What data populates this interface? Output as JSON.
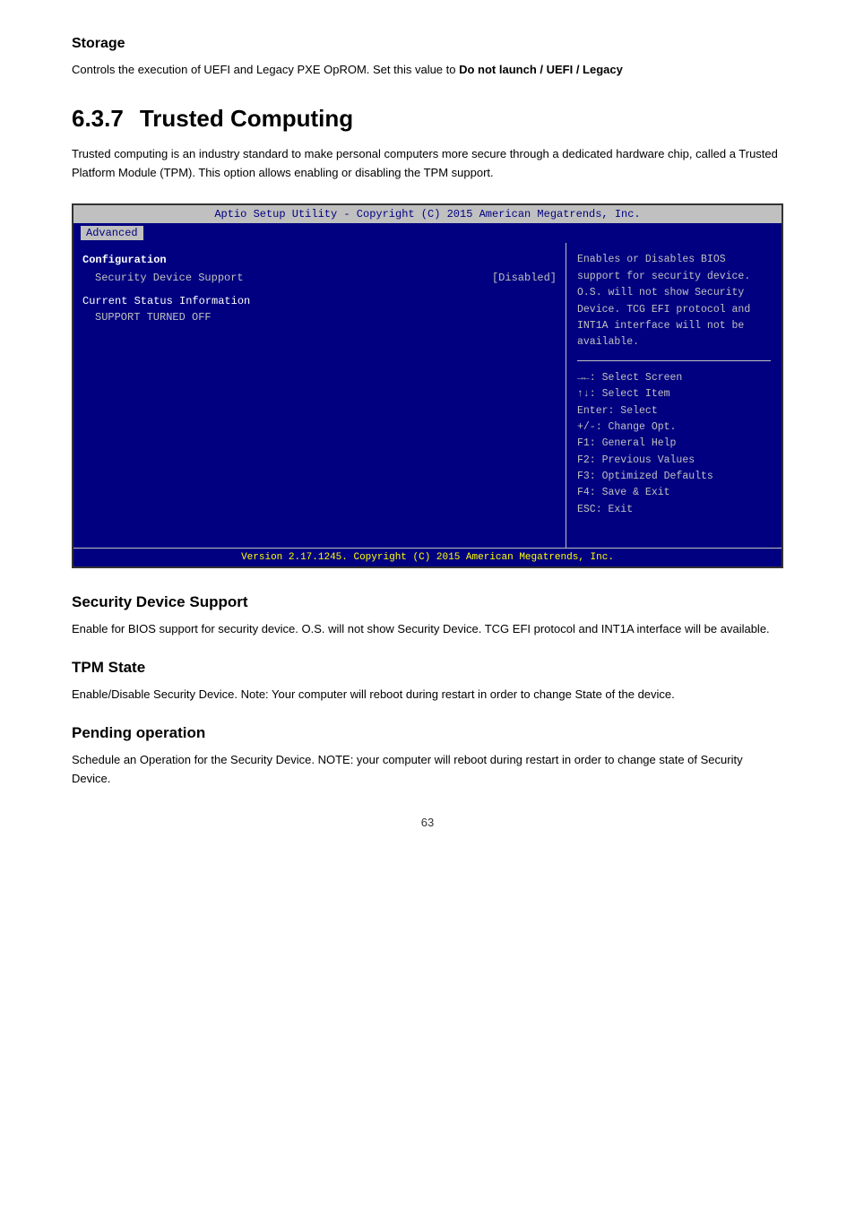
{
  "storage": {
    "title": "Storage",
    "description": "Controls the execution of UEFI and Legacy PXE OpROM. Set this value to ",
    "description_bold": "Do not launch / UEFI / Legacy"
  },
  "section": {
    "number": "6.3.7",
    "title": "Trusted Computing",
    "intro": "Trusted computing is an industry standard to make personal computers more secure through a dedicated hardware chip, called a Trusted Platform Module (TPM). This option allows enabling or disabling the TPM support."
  },
  "bios": {
    "titlebar": "Aptio Setup Utility - Copyright (C) 2015 American Megatrends, Inc.",
    "nav_item": "Advanced",
    "left": {
      "config_title": "Configuration",
      "security_device_label": "Security Device Support",
      "security_device_value": "[Disabled]",
      "status_title": "Current Status Information",
      "status_value": "SUPPORT TURNED OFF"
    },
    "right": {
      "description": "Enables or Disables BIOS support for security device. O.S. will not show Security Device. TCG EFI protocol and INT1A interface will not be available.",
      "keys": [
        "→←: Select Screen",
        "↑↓: Select Item",
        "Enter: Select",
        "+/-: Change Opt.",
        "F1: General Help",
        "F2: Previous Values",
        "F3: Optimized Defaults",
        "F4: Save & Exit",
        "ESC: Exit"
      ]
    },
    "footer": "Version 2.17.1245. Copyright (C) 2015 American Megatrends, Inc."
  },
  "security_device_support": {
    "title": "Security Device Support",
    "description": "Enable for BIOS support for security device. O.S. will not show Security Device. TCG EFI protocol and INT1A interface will be available."
  },
  "tpm_state": {
    "title": "TPM State",
    "description": "Enable/Disable Security Device. Note: Your computer will reboot during restart in order to change State of the device."
  },
  "pending_operation": {
    "title": "Pending operation",
    "description": "Schedule an Operation for the Security Device. NOTE: your computer will reboot during restart in order to change state of Security Device."
  },
  "page_number": "63"
}
